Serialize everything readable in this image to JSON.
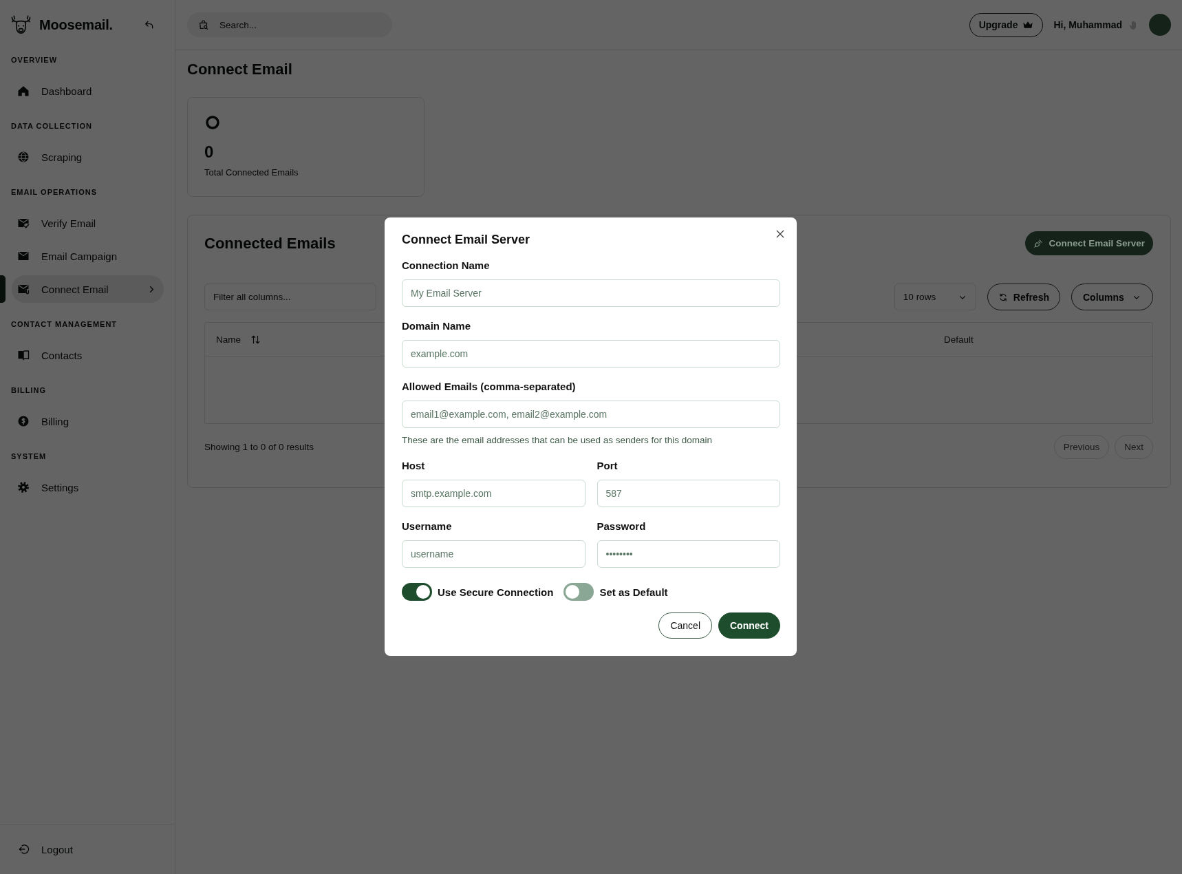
{
  "sidebar": {
    "brand": "Moosemail.",
    "sections": [
      {
        "title": "OVERVIEW",
        "items": [
          {
            "label": "Dashboard",
            "selected": false
          }
        ]
      },
      {
        "title": "DATA COLLECTION",
        "items": [
          {
            "label": "Scraping",
            "selected": false
          }
        ]
      },
      {
        "title": "EMAIL OPERATIONS",
        "items": [
          {
            "label": "Verify Email",
            "selected": false
          },
          {
            "label": "Email Campaign",
            "selected": false
          },
          {
            "label": "Connect Email",
            "selected": true
          }
        ]
      },
      {
        "title": "CONTACT MANAGEMENT",
        "items": [
          {
            "label": "Contacts",
            "selected": false
          }
        ]
      },
      {
        "title": "BILLING",
        "items": [
          {
            "label": "Billing",
            "selected": false
          }
        ]
      },
      {
        "title": "SYSTEM",
        "items": [
          {
            "label": "Settings",
            "selected": false
          }
        ]
      }
    ],
    "logout": "Logout"
  },
  "topbar": {
    "search": {
      "placeholder": "Search..."
    },
    "upgrade": "Upgrade",
    "greeting": "Hi, Muhammad"
  },
  "page": {
    "title": "Connect Email",
    "stat": {
      "value": "0",
      "label": "Total Connected Emails"
    },
    "list": {
      "title": "Connected Emails",
      "action": "Connect Email Server",
      "filter": {
        "placeholder": "Filter all columns..."
      },
      "rows_select": "10 rows",
      "refresh": "Refresh",
      "columns_button": "Columns",
      "table": {
        "columns": [
          {
            "label": "Name",
            "sortable": true
          },
          {
            "label": "Default",
            "sortable": false
          }
        ]
      },
      "summary": "Showing 1 to 0 of 0 results",
      "pagination": [
        {
          "label": "Previous",
          "disabled": true
        },
        {
          "label": "Next",
          "disabled": true
        }
      ]
    }
  },
  "modal": {
    "title": "Connect Email Server",
    "field_rows": [
      [
        {
          "label": "Connection Name",
          "placeholder": "My Email Server"
        }
      ],
      [
        {
          "label": "Domain Name",
          "placeholder": "example.com"
        }
      ],
      [
        {
          "label": "Allowed Emails (comma-separated)",
          "placeholder": "email1@example.com, email2@example.com",
          "help": "These are the email addresses that can be used as senders for this domain"
        }
      ],
      [
        {
          "label": "Host",
          "placeholder": "smtp.example.com"
        },
        {
          "label": "Port",
          "placeholder": "587"
        }
      ],
      [
        {
          "label": "Username",
          "placeholder": "username"
        },
        {
          "label": "Password",
          "placeholder": "••••••••"
        }
      ]
    ],
    "toggles": [
      {
        "label": "Use Secure Connection",
        "on": true
      },
      {
        "label": "Set as Default",
        "on": false
      }
    ],
    "buttons": [
      {
        "label": "Cancel",
        "kind": "secondary"
      },
      {
        "label": "Connect",
        "kind": "primary"
      }
    ]
  }
}
